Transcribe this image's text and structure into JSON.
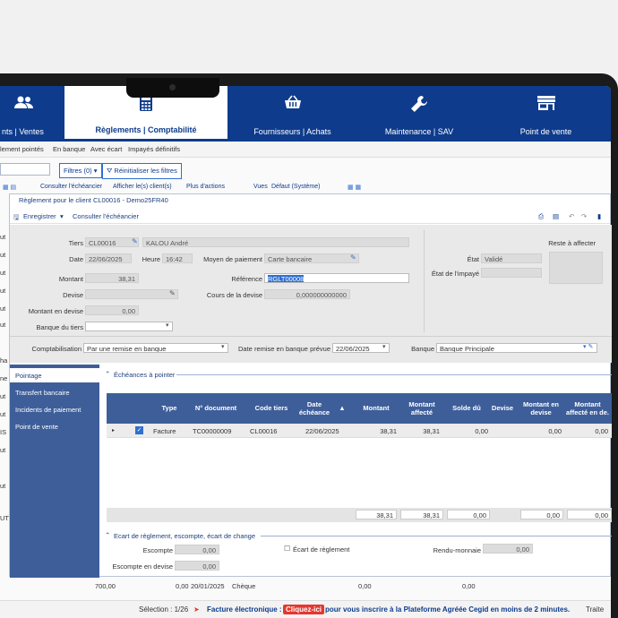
{
  "ribbon": {
    "tabs": [
      {
        "label": "nts | Ventes",
        "icon": "users-icon"
      },
      {
        "label": "Règlements | Comptabilité",
        "icon": "calculator-icon"
      },
      {
        "label": "Fournisseurs | Achats",
        "icon": "basket-icon"
      },
      {
        "label": "Maintenance | SAV",
        "icon": "wrench-icon"
      },
      {
        "label": "Point de vente",
        "icon": "store-icon"
      }
    ],
    "active_color": "#0e3b8c"
  },
  "subnav": [
    "lement pointés",
    "En banque",
    "Avec écart",
    "Impayés définitifs"
  ],
  "filters": {
    "filters_label": "Filtres (0)",
    "reset_label": "Réinitialiser les filtres"
  },
  "toolbar2": [
    "Consulter l'échéancier",
    "Afficher le(s) client(s)",
    "Plus d'actions",
    "Vues",
    "Défaut (Système)"
  ],
  "dialog": {
    "title": "Règlement pour le client CL00016 - Demo25FR40",
    "save_label": "Enregistrer",
    "schedule_label": "Consulter l'échéancier"
  },
  "form": {
    "tiers_label": "Tiers",
    "tiers_code": "CL00016",
    "tiers_name": "KALOU André",
    "date_label": "Date",
    "date_value": "22/06/2025",
    "heure_label": "Heure",
    "heure_value": "16:42",
    "moyen_label": "Moyen de paiement",
    "moyen_value": "Carte bancaire",
    "montant_label": "Montant",
    "montant_value": "38,31",
    "reference_label": "Référence",
    "reference_value": "RGLT00008",
    "devise_label": "Devise",
    "devise_value": "",
    "cours_label": "Cours de la devise",
    "cours_value": "0,000000000000",
    "montant_devise_label": "Montant en devise",
    "montant_devise_value": "0,00",
    "banque_tiers_label": "Banque du tiers",
    "banque_tiers_value": "",
    "etat_label": "État",
    "etat_value": "Validé",
    "etat_impaye_label": "État de l'impayé",
    "etat_impaye_value": "",
    "reste_label": "Reste à affecter",
    "compta_label": "Comptabilisation",
    "compta_value": "Par une remise en banque",
    "date_remise_label": "Date remise en banque prévue",
    "date_remise_value": "22/06/2025",
    "banque_label": "Banque",
    "banque_value": "Banque Principale"
  },
  "side_tabs": [
    "Pointage",
    "Transfert bancaire",
    "Incidents de paiement",
    "Point de vente"
  ],
  "grid": {
    "section_title": "Échéances à pointer",
    "columns": [
      "Type",
      "N° document",
      "Code tiers",
      "Date échéance",
      "Montant",
      "Montant affecté",
      "Solde dû",
      "Devise",
      "Montant en devise",
      "Montant affecté en de."
    ],
    "rows": [
      {
        "type": "Facture",
        "doc": "TC00000009",
        "tiers": "CL00016",
        "date": "22/06/2025",
        "montant": "38,31",
        "affecte": "38,31",
        "solde": "0,00",
        "devise": "",
        "mdevise": "0,00",
        "mad": "0,00"
      }
    ],
    "totals": {
      "montant": "38,31",
      "affecte": "38,31",
      "solde": "0,00",
      "mdevise": "0,00",
      "mad": "0,00"
    }
  },
  "ecart": {
    "section_title": "Ecart de règlement, escompte, écart de change",
    "escompte_label": "Escompte",
    "escompte_value": "0,00",
    "escompte_devise_label": "Escompte en devise",
    "escompte_devise_value": "0,00",
    "ecart_label": "Écart de règlement",
    "rendu_label": "Rendu-monnaie",
    "rendu_value": "0,00"
  },
  "left_edge": [
    "ut",
    "ut",
    "ut",
    "ut",
    "ut",
    "ut",
    "ha",
    "ne",
    "ut",
    "ut",
    "IS",
    "ut",
    "ut",
    "UT"
  ],
  "bottom_row": {
    "a": "700,00",
    "b": "0,00",
    "date": "20/01/2025",
    "mode": "Chèque",
    "c": "0,00",
    "d": "0,00"
  },
  "status": {
    "selection": "Sélection : 1/26",
    "facture": "Facture électronique :",
    "cta": "Cliquez-ici",
    "message": "pour vous inscrire à la Plateforme Agréée Cegid en moins de 2 minutes.",
    "right": "Traite"
  }
}
